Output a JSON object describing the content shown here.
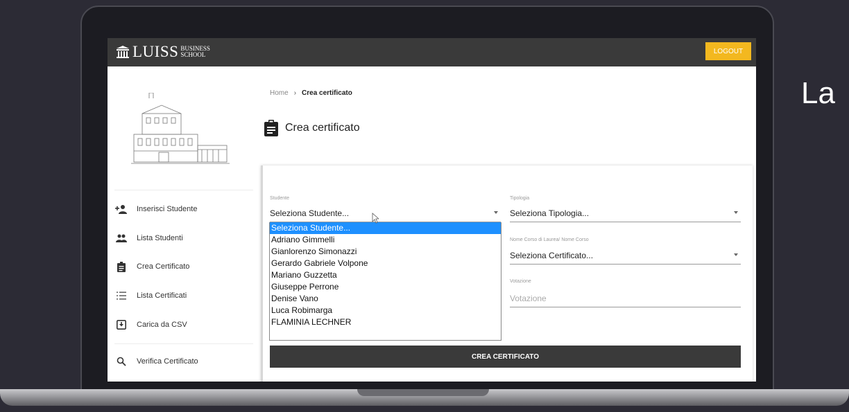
{
  "header": {
    "logo_main": "LUISS",
    "logo_sub_1": "BUSINESS",
    "logo_sub_2": "SCHOOL",
    "logout_label": "LOGOUT"
  },
  "sidebar": {
    "items": [
      {
        "label": "Inserisci Studente",
        "icon": "add-user-icon"
      },
      {
        "label": "Lista Studenti",
        "icon": "users-icon"
      },
      {
        "label": "Crea Certificato",
        "icon": "clipboard-icon"
      },
      {
        "label": "Lista Certificati",
        "icon": "list-icon"
      },
      {
        "label": "Carica da CSV",
        "icon": "upload-icon"
      },
      {
        "label": "Verifica Certificato",
        "icon": "search-icon"
      }
    ]
  },
  "breadcrumb": {
    "home": "Home",
    "separator": "›",
    "current": "Crea certificato"
  },
  "page": {
    "title": "Crea certificato"
  },
  "form": {
    "student": {
      "label": "Studente",
      "value": "Seleziona Studente..."
    },
    "typology": {
      "label": "Tipologia",
      "value": "Seleziona Tipologia..."
    },
    "course": {
      "label": "Nome Corso di Laurea/ Nome Corso",
      "value": "Seleziona Certificato..."
    },
    "grade": {
      "label": "Votazione",
      "placeholder": "Votazione"
    },
    "submit_label": "CREA CERTIFICATO",
    "student_options": [
      "Seleziona Studente...",
      "Adriano Gimmelli",
      "Gianlorenzo Simonazzi",
      "Gerardo Gabriele Volpone",
      "Mariano Guzzetta",
      "Giuseppe Perrone",
      "Denise Vano",
      "Luca Robimarga",
      "FLAMINIA LECHNER"
    ]
  },
  "side_text": "La",
  "colors": {
    "header_bg": "#3a3a3a",
    "logout_bg": "#f3b81f",
    "selection": "#1e90ff"
  }
}
